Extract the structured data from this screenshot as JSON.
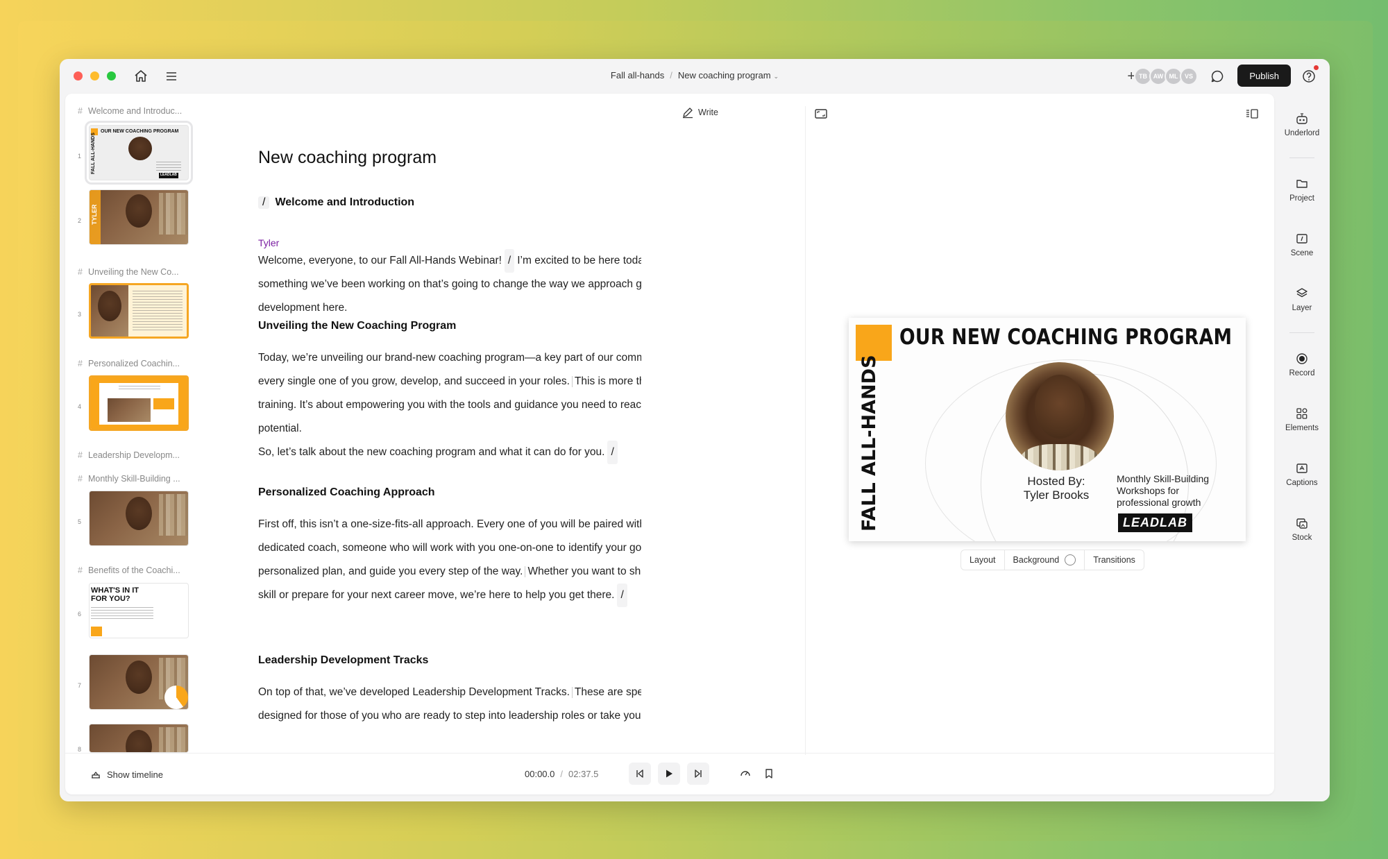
{
  "titlebar": {
    "breadcrumb_project": "Fall all-hands",
    "breadcrumb_separator": "/",
    "breadcrumb_doc": "New coaching program",
    "collaborators": [
      "TB",
      "AW",
      "ML",
      "VS"
    ],
    "publish_label": "Publish"
  },
  "scenes": [
    {
      "header": "Welcome and Introduc...",
      "num": "1"
    },
    {
      "num": "2"
    },
    {
      "header": "Unveiling the New Co...",
      "num": "3"
    },
    {
      "header": "Personalized Coachin...",
      "num": "4"
    },
    {
      "header": "Leadership Developm..."
    },
    {
      "header": "Monthly Skill-Building ...",
      "num": "5"
    },
    {
      "header": "Benefits of the Coachi...",
      "num": "6"
    },
    {
      "num": "7"
    },
    {
      "num": "8"
    }
  ],
  "thumb_text": {
    "t1_title": "OUR NEW COACHING PROGRAM",
    "t1_vert": "FALL ALL-HANDS",
    "t1_logo": "LEADLAB",
    "t2_name": "TYLER",
    "t6_title": "WHAT'S IN IT FOR YOU?"
  },
  "script": {
    "write_label": "Write",
    "title": "New coaching program",
    "speaker": "Tyler",
    "sections": [
      {
        "slash": "/",
        "title": "Welcome and Introduction"
      },
      {
        "title": "Unveiling the New Coaching Program"
      },
      {
        "title": "Personalized Coaching Approach"
      },
      {
        "title": "Leadership Development Tracks"
      }
    ],
    "p1a": "Welcome, everyone, to our Fall All-Hands Webinar!",
    "p1slash": "/",
    "p1b": "I’m excited to be here today to share something we’ve been working on that’s going to change the way we approach growth and development here.",
    "p2a": "Today, we’re unveiling our brand-new coaching program—a key part of our commitment to helping every single one of you grow, develop, and succeed in your roles.",
    "p2b": "This is more than just another training. It’s about empowering you with the tools and guidance you need to reach your full potential.",
    "p3": "So, let’s talk about the new coaching program and what it can do for you.",
    "p3slash": "/",
    "p4a": "First off, this isn’t a one-size-fits-all approach. Every one of you will be paired with your own dedicated coach, someone who will work with you one-on-one to identify your goals, map out a personalized plan, and guide you every step of the way.",
    "p4b": "Whether you want to sharpen a specific skill or prepare for your next career move, we’re here to help you get there.",
    "p4slash": "/",
    "p5a": "On top of that, we’ve developed Leadership Development Tracks.",
    "p5b": "These are specifically designed for those of you who are ready to step into leadership roles or take your"
  },
  "slide": {
    "title": "OUR NEW COACHING PROGRAM",
    "vertical": "FALL ALL-HANDS",
    "hosted_by": "Hosted By:",
    "host_name": "Tyler Brooks",
    "workshop_text": "Monthly Skill-Building Workshops for professional growth",
    "logo": "LEADLAB",
    "accent": "#f9a61a"
  },
  "slide_toolbar": {
    "layout": "Layout",
    "background": "Background",
    "transitions": "Transitions"
  },
  "player": {
    "show_timeline": "Show timeline",
    "current": "00:00.0",
    "separator": "/",
    "total": "02:37.5"
  },
  "rail": [
    {
      "label": "Underlord"
    },
    {
      "label": "Project"
    },
    {
      "label": "Scene"
    },
    {
      "label": "Layer"
    },
    {
      "label": "Record"
    },
    {
      "label": "Elements"
    },
    {
      "label": "Captions"
    },
    {
      "label": "Stock"
    }
  ]
}
